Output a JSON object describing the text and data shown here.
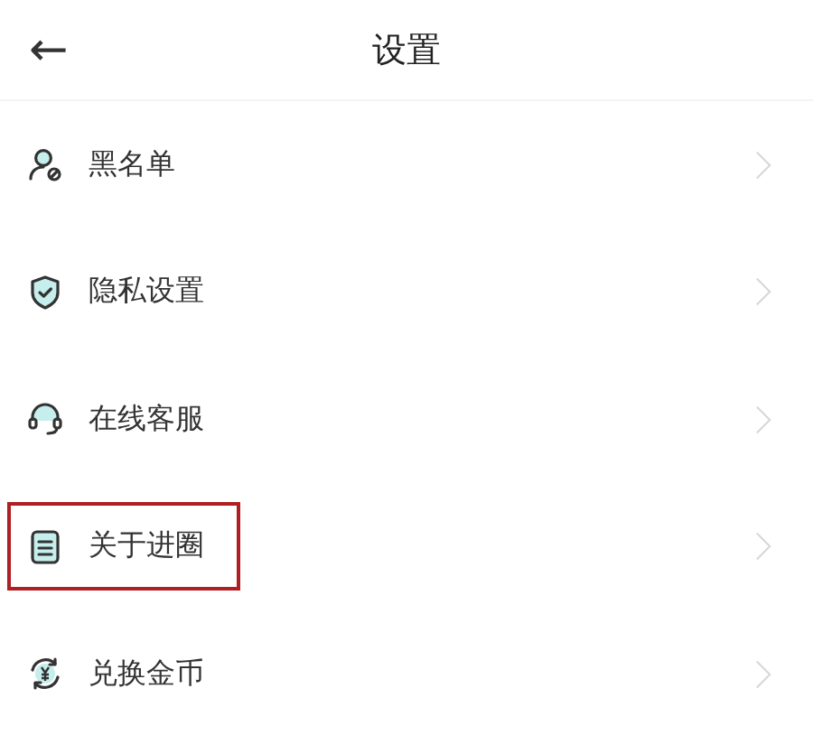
{
  "header": {
    "back": "←",
    "title": "设置"
  },
  "items": [
    {
      "label": "黑名单",
      "highlighted": false
    },
    {
      "label": "隐私设置",
      "highlighted": false
    },
    {
      "label": "在线客服",
      "highlighted": false
    },
    {
      "label": "关于进圈",
      "highlighted": true
    },
    {
      "label": "兑换金币",
      "highlighted": false
    }
  ]
}
